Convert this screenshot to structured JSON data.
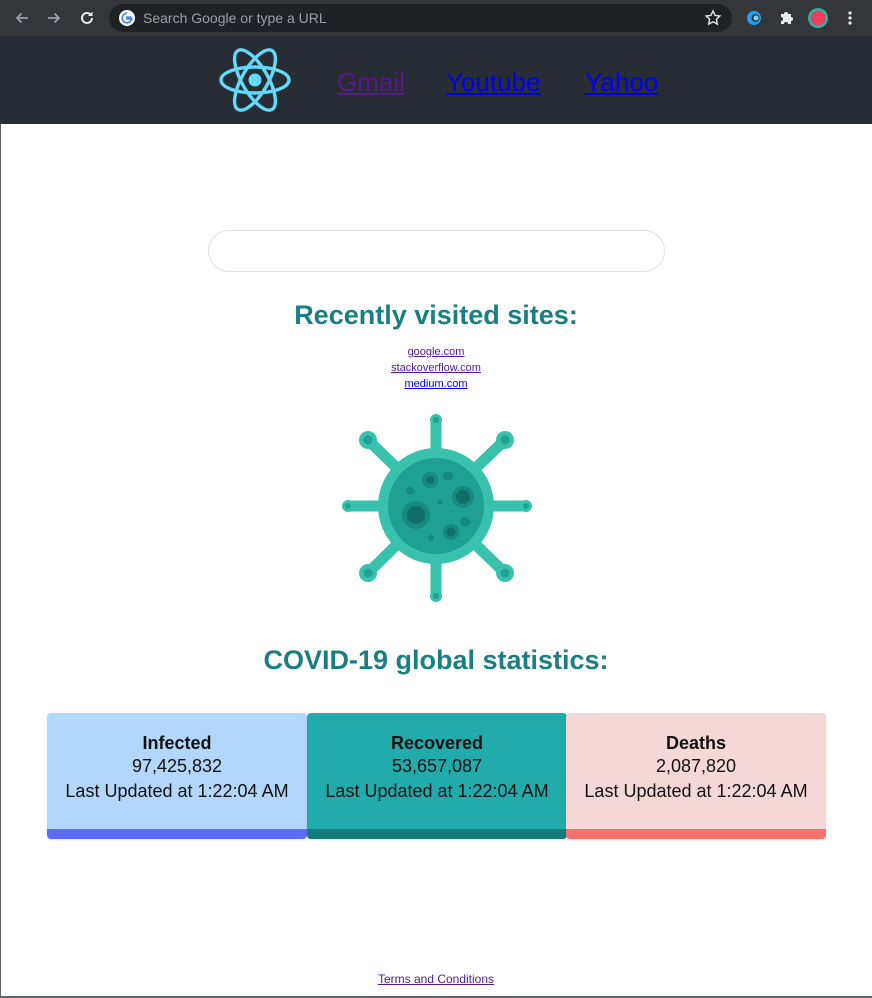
{
  "browser": {
    "omnibox_placeholder": "Search Google or type a URL",
    "icons": [
      "back-arrow-icon",
      "forward-arrow-icon",
      "reload-icon",
      "google-g-icon",
      "bookmark-star-icon",
      "extension-icon",
      "puzzle-icon",
      "profile-avatar-icon",
      "kebab-menu-icon"
    ]
  },
  "header": {
    "nav": [
      {
        "label": "Gmail",
        "visited": true
      },
      {
        "label": "Youtube",
        "visited": false
      },
      {
        "label": "Yahoo",
        "visited": false
      }
    ],
    "logo_icon": "react-logo-icon",
    "colors": {
      "background": "#282c34",
      "logo": "#61dafb"
    }
  },
  "main": {
    "search_value": "",
    "recent_heading": "Recently visited sites:",
    "recent_sites": [
      {
        "label": "google.com",
        "visited": true
      },
      {
        "label": "stackoverflow.com",
        "visited": true
      },
      {
        "label": "medium.com",
        "visited": false
      }
    ],
    "virus_icon": "virus-icon",
    "stats_heading": "COVID-19 global statistics:",
    "heading_color": "#1a7f84"
  },
  "stats": [
    {
      "title": "Infected",
      "value": "97,425,832",
      "updated": "Last Updated at 1:22:04 AM",
      "bg": "#b3d7fb",
      "bar": "#5b6cff"
    },
    {
      "title": "Recovered",
      "value": "53,657,087",
      "updated": "Last Updated at 1:22:04 AM",
      "bg": "#21abab",
      "bar": "#127b7b"
    },
    {
      "title": "Deaths",
      "value": "2,087,820",
      "updated": "Last Updated at 1:22:04 AM",
      "bg": "#f5d7d8",
      "bar": "#f6716c"
    }
  ],
  "footer": {
    "terms_label": "Terms and Conditions"
  }
}
